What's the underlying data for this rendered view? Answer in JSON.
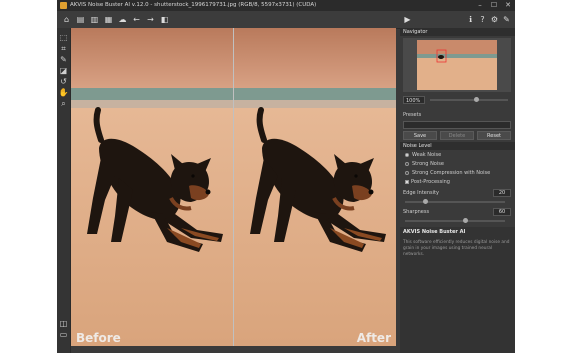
{
  "window": {
    "title": "AKVIS Noise Buster AI v.12.0 - shutterstock_1996179731.jpg (RGB/8, 5597x3731) (CUDA)",
    "minimize": "–",
    "maximize": "☐",
    "close": "✕"
  },
  "toolbar": {
    "left": [
      {
        "name": "home-icon",
        "glyph": "⌂"
      },
      {
        "name": "open-file-icon",
        "glyph": "▤"
      },
      {
        "name": "save-file-icon",
        "glyph": "▥"
      },
      {
        "name": "print-icon",
        "glyph": "▦"
      },
      {
        "name": "share-icon",
        "glyph": "☁"
      },
      {
        "name": "undo-icon",
        "glyph": "←"
      },
      {
        "name": "redo-icon",
        "glyph": "→"
      },
      {
        "name": "batch-icon",
        "glyph": "◧"
      }
    ],
    "run": {
      "name": "run-icon",
      "glyph": "▶"
    },
    "right": [
      {
        "name": "info-icon",
        "glyph": "ℹ"
      },
      {
        "name": "help-icon",
        "glyph": "?"
      },
      {
        "name": "settings-icon",
        "glyph": "⚙"
      },
      {
        "name": "tips-icon",
        "glyph": "✎"
      }
    ]
  },
  "tools": [
    {
      "name": "selection-tool-icon",
      "glyph": "⬚"
    },
    {
      "name": "crop-tool-icon",
      "glyph": "⌗"
    },
    {
      "name": "brush-tool-icon",
      "glyph": "✎"
    },
    {
      "name": "eraser-tool-icon",
      "glyph": "◪"
    },
    {
      "name": "history-brush-icon",
      "glyph": "↺"
    },
    {
      "name": "hand-tool-icon",
      "glyph": "✋"
    },
    {
      "name": "zoom-tool-icon",
      "glyph": "⌕"
    }
  ],
  "view_modes": [
    {
      "name": "split-view-icon",
      "glyph": "◫"
    },
    {
      "name": "single-view-icon",
      "glyph": "▭"
    }
  ],
  "canvas": {
    "before_label": "Before",
    "after_label": "After"
  },
  "navigator": {
    "title": "Navigator",
    "zoom": "100%",
    "zoom_level": 0.6
  },
  "presets": {
    "title": "Presets",
    "save": "Save",
    "delete": "Delete",
    "reset": "Reset"
  },
  "noise_level": {
    "title": "Noise Level",
    "options": [
      "Weak Noise",
      "Strong Noise",
      "Strong Compression with Noise"
    ],
    "selected": 0
  },
  "post_processing": {
    "label": "Post-Processing",
    "checked": true,
    "edge_intensity": {
      "label": "Edge Intensity",
      "value": "20",
      "level": 0.2
    },
    "sharpness": {
      "label": "Sharpness",
      "value": "60",
      "level": 0.6
    }
  },
  "help": {
    "title": "AKVIS Noise Buster AI",
    "body": "This software efficiently reduces digital noise and grain in your images using trained neural networks."
  },
  "colors": {
    "sky": "#c98a6b",
    "water": "#7e9a90",
    "sand": "#e7b78f",
    "dog": "#1e150f",
    "dog_tan": "#8a4a22"
  }
}
